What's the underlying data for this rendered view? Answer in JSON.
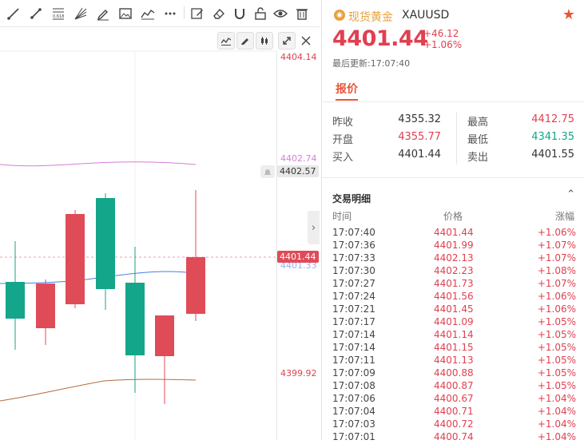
{
  "toolbar": {
    "icons": [
      "line-tool-icon",
      "ray-tool-icon",
      "fibonacci-icon",
      "fan-icon",
      "pen-icon",
      "image-icon",
      "pattern-icon",
      "more-icon",
      "edit-icon",
      "eraser-icon",
      "magnet-icon",
      "lock-icon",
      "eye-icon",
      "trash-icon"
    ],
    "fib_label": "0.618"
  },
  "chart": {
    "price_levels": [
      "4404.14",
      "4402.74",
      "4399.92"
    ],
    "bell_tag": "4402.57",
    "current_tag": "4401.44",
    "underlying_label": "4401.33",
    "colors": {
      "up": "#e04b58",
      "down": "#14a68a",
      "ma_pink": "#d57fd6",
      "ma_blue": "#4a7de0",
      "ma_brown": "#b56a3c"
    }
  },
  "quote": {
    "name": "现货黄金",
    "symbol": "XAUUSD",
    "price": "4401.44",
    "change": "+46.12",
    "change_pct": "+1.06%",
    "updated": "最后更新:17:07:40",
    "tab": "报价",
    "stats": {
      "prev_close_label": "昨收",
      "prev_close": "4355.32",
      "open_label": "开盘",
      "open": "4355.77",
      "bid_label": "买入",
      "bid": "4401.44",
      "high_label": "最高",
      "high": "4412.75",
      "low_label": "最低",
      "low": "4341.35",
      "ask_label": "卖出",
      "ask": "4401.55"
    }
  },
  "trades": {
    "title": "交易明细",
    "headers": {
      "time": "时间",
      "price": "价格",
      "pct": "涨幅"
    },
    "rows": [
      {
        "time": "17:07:40",
        "price": "4401.44",
        "pct": "+1.06%"
      },
      {
        "time": "17:07:36",
        "price": "4401.99",
        "pct": "+1.07%"
      },
      {
        "time": "17:07:33",
        "price": "4402.13",
        "pct": "+1.07%"
      },
      {
        "time": "17:07:30",
        "price": "4402.23",
        "pct": "+1.08%"
      },
      {
        "time": "17:07:27",
        "price": "4401.73",
        "pct": "+1.07%"
      },
      {
        "time": "17:07:24",
        "price": "4401.56",
        "pct": "+1.06%"
      },
      {
        "time": "17:07:21",
        "price": "4401.45",
        "pct": "+1.06%"
      },
      {
        "time": "17:07:17",
        "price": "4401.09",
        "pct": "+1.05%"
      },
      {
        "time": "17:07:14",
        "price": "4401.14",
        "pct": "+1.05%"
      },
      {
        "time": "17:07:14",
        "price": "4401.15",
        "pct": "+1.05%"
      },
      {
        "time": "17:07:11",
        "price": "4401.13",
        "pct": "+1.05%"
      },
      {
        "time": "17:07:09",
        "price": "4400.88",
        "pct": "+1.05%"
      },
      {
        "time": "17:07:08",
        "price": "4400.87",
        "pct": "+1.05%"
      },
      {
        "time": "17:07:06",
        "price": "4400.67",
        "pct": "+1.04%"
      },
      {
        "time": "17:07:04",
        "price": "4400.71",
        "pct": "+1.04%"
      },
      {
        "time": "17:07:03",
        "price": "4400.72",
        "pct": "+1.04%"
      },
      {
        "time": "17:07:01",
        "price": "4400.74",
        "pct": "+1.04%"
      }
    ]
  }
}
